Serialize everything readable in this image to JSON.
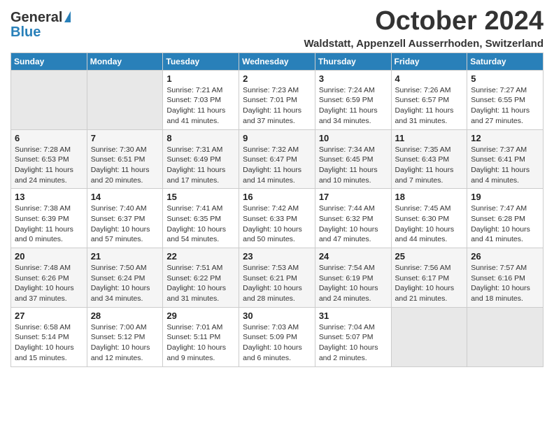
{
  "header": {
    "logo_general": "General",
    "logo_blue": "Blue",
    "month_title": "October 2024",
    "location": "Waldstatt, Appenzell Ausserrhoden, Switzerland"
  },
  "weekdays": [
    "Sunday",
    "Monday",
    "Tuesday",
    "Wednesday",
    "Thursday",
    "Friday",
    "Saturday"
  ],
  "weeks": [
    [
      {
        "day": "",
        "info": ""
      },
      {
        "day": "",
        "info": ""
      },
      {
        "day": "1",
        "info": "Sunrise: 7:21 AM\nSunset: 7:03 PM\nDaylight: 11 hours and 41 minutes."
      },
      {
        "day": "2",
        "info": "Sunrise: 7:23 AM\nSunset: 7:01 PM\nDaylight: 11 hours and 37 minutes."
      },
      {
        "day": "3",
        "info": "Sunrise: 7:24 AM\nSunset: 6:59 PM\nDaylight: 11 hours and 34 minutes."
      },
      {
        "day": "4",
        "info": "Sunrise: 7:26 AM\nSunset: 6:57 PM\nDaylight: 11 hours and 31 minutes."
      },
      {
        "day": "5",
        "info": "Sunrise: 7:27 AM\nSunset: 6:55 PM\nDaylight: 11 hours and 27 minutes."
      }
    ],
    [
      {
        "day": "6",
        "info": "Sunrise: 7:28 AM\nSunset: 6:53 PM\nDaylight: 11 hours and 24 minutes."
      },
      {
        "day": "7",
        "info": "Sunrise: 7:30 AM\nSunset: 6:51 PM\nDaylight: 11 hours and 20 minutes."
      },
      {
        "day": "8",
        "info": "Sunrise: 7:31 AM\nSunset: 6:49 PM\nDaylight: 11 hours and 17 minutes."
      },
      {
        "day": "9",
        "info": "Sunrise: 7:32 AM\nSunset: 6:47 PM\nDaylight: 11 hours and 14 minutes."
      },
      {
        "day": "10",
        "info": "Sunrise: 7:34 AM\nSunset: 6:45 PM\nDaylight: 11 hours and 10 minutes."
      },
      {
        "day": "11",
        "info": "Sunrise: 7:35 AM\nSunset: 6:43 PM\nDaylight: 11 hours and 7 minutes."
      },
      {
        "day": "12",
        "info": "Sunrise: 7:37 AM\nSunset: 6:41 PM\nDaylight: 11 hours and 4 minutes."
      }
    ],
    [
      {
        "day": "13",
        "info": "Sunrise: 7:38 AM\nSunset: 6:39 PM\nDaylight: 11 hours and 0 minutes."
      },
      {
        "day": "14",
        "info": "Sunrise: 7:40 AM\nSunset: 6:37 PM\nDaylight: 10 hours and 57 minutes."
      },
      {
        "day": "15",
        "info": "Sunrise: 7:41 AM\nSunset: 6:35 PM\nDaylight: 10 hours and 54 minutes."
      },
      {
        "day": "16",
        "info": "Sunrise: 7:42 AM\nSunset: 6:33 PM\nDaylight: 10 hours and 50 minutes."
      },
      {
        "day": "17",
        "info": "Sunrise: 7:44 AM\nSunset: 6:32 PM\nDaylight: 10 hours and 47 minutes."
      },
      {
        "day": "18",
        "info": "Sunrise: 7:45 AM\nSunset: 6:30 PM\nDaylight: 10 hours and 44 minutes."
      },
      {
        "day": "19",
        "info": "Sunrise: 7:47 AM\nSunset: 6:28 PM\nDaylight: 10 hours and 41 minutes."
      }
    ],
    [
      {
        "day": "20",
        "info": "Sunrise: 7:48 AM\nSunset: 6:26 PM\nDaylight: 10 hours and 37 minutes."
      },
      {
        "day": "21",
        "info": "Sunrise: 7:50 AM\nSunset: 6:24 PM\nDaylight: 10 hours and 34 minutes."
      },
      {
        "day": "22",
        "info": "Sunrise: 7:51 AM\nSunset: 6:22 PM\nDaylight: 10 hours and 31 minutes."
      },
      {
        "day": "23",
        "info": "Sunrise: 7:53 AM\nSunset: 6:21 PM\nDaylight: 10 hours and 28 minutes."
      },
      {
        "day": "24",
        "info": "Sunrise: 7:54 AM\nSunset: 6:19 PM\nDaylight: 10 hours and 24 minutes."
      },
      {
        "day": "25",
        "info": "Sunrise: 7:56 AM\nSunset: 6:17 PM\nDaylight: 10 hours and 21 minutes."
      },
      {
        "day": "26",
        "info": "Sunrise: 7:57 AM\nSunset: 6:16 PM\nDaylight: 10 hours and 18 minutes."
      }
    ],
    [
      {
        "day": "27",
        "info": "Sunrise: 6:58 AM\nSunset: 5:14 PM\nDaylight: 10 hours and 15 minutes."
      },
      {
        "day": "28",
        "info": "Sunrise: 7:00 AM\nSunset: 5:12 PM\nDaylight: 10 hours and 12 minutes."
      },
      {
        "day": "29",
        "info": "Sunrise: 7:01 AM\nSunset: 5:11 PM\nDaylight: 10 hours and 9 minutes."
      },
      {
        "day": "30",
        "info": "Sunrise: 7:03 AM\nSunset: 5:09 PM\nDaylight: 10 hours and 6 minutes."
      },
      {
        "day": "31",
        "info": "Sunrise: 7:04 AM\nSunset: 5:07 PM\nDaylight: 10 hours and 2 minutes."
      },
      {
        "day": "",
        "info": ""
      },
      {
        "day": "",
        "info": ""
      }
    ]
  ]
}
